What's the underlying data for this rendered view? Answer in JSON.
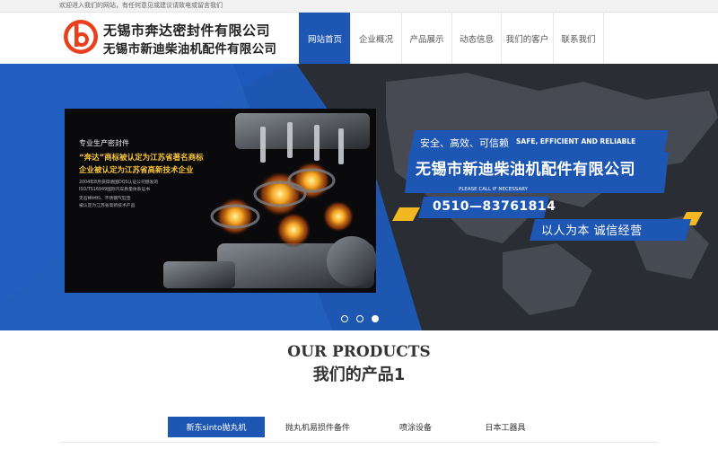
{
  "topbar": {
    "notice": "欢迎进入我们的网站，有任何意见或建议请致电或留言我们"
  },
  "header": {
    "company_name_1": "无锡市奔达密封件有限公司",
    "company_name_2": "无锡市新迪柴油机配件有限公司",
    "nav": [
      {
        "label": "网站首页",
        "active": true
      },
      {
        "label": "企业概况",
        "active": false
      },
      {
        "label": "产品展示",
        "active": false
      },
      {
        "label": "动态信息",
        "active": false
      },
      {
        "label": "我们的客户",
        "active": false
      },
      {
        "label": "联系我们",
        "active": false
      }
    ]
  },
  "banner": {
    "engine_panel": {
      "title": "专业生产密封件",
      "line1": "“奔达”商标被认定为江苏省著名商标",
      "line2": "企业被认定为江苏省高新技术企业",
      "small1": "2004年8月获得德国DQS认证公司颁发的",
      "small2": "ISO/TS16949国际汽车质量体系证书",
      "small3": "无石棉材料、不锈钢气缸垫",
      "small4": "被认定为江苏省高新技术产品"
    },
    "slogan_cn": "安全、高效、可信赖",
    "slogan_en": "SAFE, EFFICIENT AND RELIABLE",
    "company": "无锡市新迪柴油机配件有限公司",
    "call_text": "PLEASE CALL IF NECESSARY",
    "phone": "0510—83761814",
    "motto": "以人为本  诚信经营",
    "slides": 3,
    "active_slide": 3
  },
  "products": {
    "title_en": "OUR PRODUCTS",
    "title_cn": "我们的产品1",
    "tabs": [
      {
        "label": "新东sinto抛丸机",
        "active": true
      },
      {
        "label": "抛丸机易损件备件",
        "active": false
      },
      {
        "label": "喷涂设备",
        "active": false
      },
      {
        "label": "日本工器具",
        "active": false
      }
    ]
  },
  "colors": {
    "primary_blue": "#1e56b3",
    "accent_yellow": "#f2b824",
    "banner_dark": "#2a2d33"
  }
}
